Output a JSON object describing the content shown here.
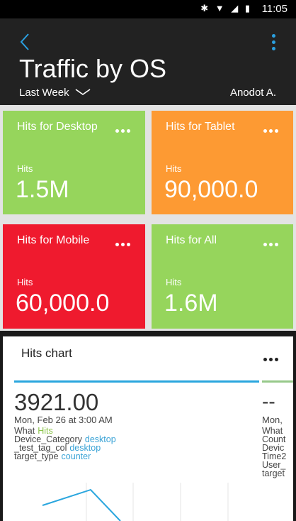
{
  "status_bar": {
    "time": "11:05",
    "icons": [
      "bluetooth-icon",
      "wifi-icon",
      "cellular-icon",
      "battery-icon"
    ]
  },
  "header": {
    "title": "Traffic by OS",
    "range": "Last Week",
    "user": "Anodot A."
  },
  "colors": {
    "green": "#96d55c",
    "orange": "#fd9a33",
    "red": "#ef1a2e",
    "accent": "#2aa6de"
  },
  "tiles": [
    {
      "name": "Hits for Desktop",
      "metric_label": "Hits",
      "value": "1.5M"
    },
    {
      "name": "Hits for Tablet",
      "metric_label": "Hits",
      "value": "90,000.0"
    },
    {
      "name": "Hits for Mobile",
      "metric_label": "Hits",
      "value": "60,000.0"
    },
    {
      "name": "Hits for All",
      "metric_label": "Hits",
      "value": "1.6M"
    }
  ],
  "chart_card": {
    "title": "Hits chart",
    "primary": {
      "value": "3921.00",
      "timestamp": "Mon, Feb 26 at 3:00 AM",
      "rows": [
        {
          "key": "What",
          "value": "Hits"
        },
        {
          "key": "Device_Category",
          "value": "desktop"
        },
        {
          "key": "_test_tag_col",
          "value": "desktop"
        },
        {
          "key": "target_type",
          "value": "counter"
        }
      ]
    },
    "secondary": {
      "value": "--",
      "timestamp": "Mon,",
      "rows": [
        "What",
        "Count",
        "Devic",
        "Time2",
        "User_",
        "target"
      ]
    }
  }
}
